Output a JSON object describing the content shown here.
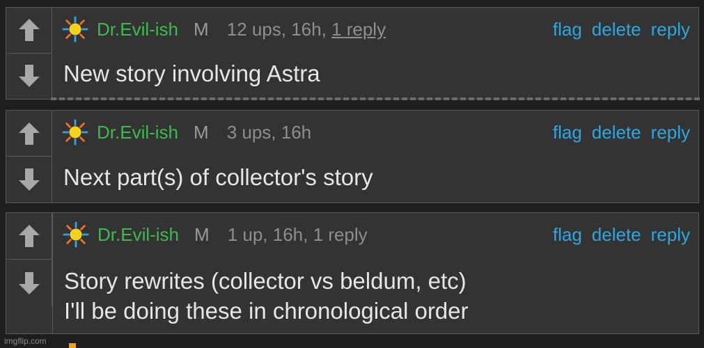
{
  "comments": [
    {
      "user": "Dr.Evil-ish",
      "badge": "M",
      "stats_pre": "12 ups, 16h, ",
      "reply_link": "1 reply",
      "actions": [
        "flag",
        "delete",
        "reply"
      ],
      "text": [
        "New story involving Astra"
      ]
    },
    {
      "user": "Dr.Evil-ish",
      "badge": "M",
      "stats": "3 ups, 16h",
      "actions": [
        "flag",
        "delete",
        "reply"
      ],
      "text": [
        "Next part(s) of collector's story"
      ]
    },
    {
      "user": "Dr.Evil-ish",
      "badge": "M",
      "stats": "1 up, 16h, 1 reply",
      "actions": [
        "flag",
        "delete",
        "reply"
      ],
      "text": [
        "Story rewrites (collector vs beldum, etc)",
        "I'll be doing these in chronological order"
      ]
    }
  ],
  "watermark": "imgflip.com",
  "colors": {
    "username": "#3fb950",
    "action": "#2ea6e0",
    "panel": "#333333",
    "background": "#1e1e1e"
  },
  "icons": [
    "sun-icon",
    "upvote-arrow-icon",
    "downvote-arrow-icon"
  ]
}
